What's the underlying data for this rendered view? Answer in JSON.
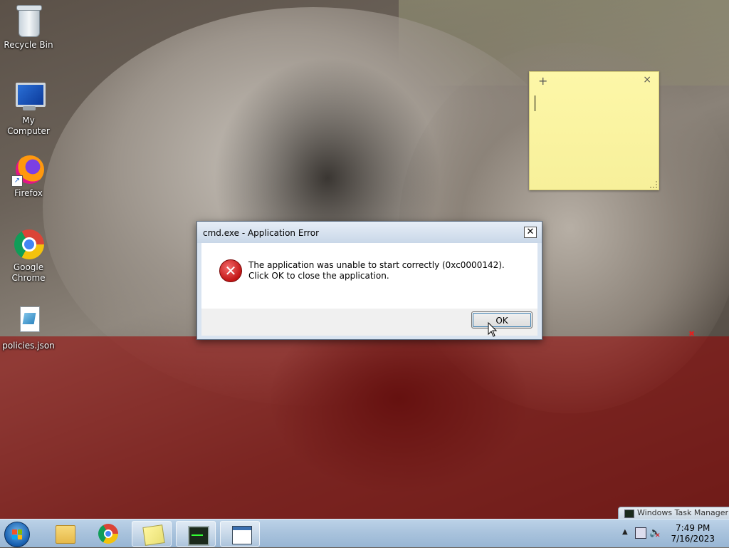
{
  "desktop": {
    "icons": [
      {
        "label": "Recycle Bin",
        "icon": "recycle-bin-icon"
      },
      {
        "label": "My Computer",
        "icon": "computer-icon"
      },
      {
        "label": "Firefox",
        "icon": "firefox-icon"
      },
      {
        "label": "Google Chrome",
        "icon": "chrome-icon"
      },
      {
        "label": "policies.json",
        "icon": "json-file-icon"
      }
    ]
  },
  "sticky_note": {
    "add_symbol": "+",
    "close_symbol": "×"
  },
  "dialog": {
    "title": "cmd.exe - Application Error",
    "close_symbol": "✕",
    "message": "The application was unable to start correctly (0xc0000142). Click OK to close the application.",
    "ok_label": "OK",
    "icon": "error-icon"
  },
  "taskbar": {
    "pinned": [
      {
        "name": "windows-explorer",
        "icon": "folder-icon"
      },
      {
        "name": "google-chrome",
        "icon": "chrome-icon"
      },
      {
        "name": "sticky-notes",
        "icon": "sticky-notes-icon"
      },
      {
        "name": "task-manager",
        "icon": "task-manager-icon"
      },
      {
        "name": "cmd-window",
        "icon": "window-icon"
      }
    ],
    "preview_label": "Windows Task Manager",
    "tray": {
      "show_hidden_symbol": "▲",
      "time": "7:49 PM",
      "date": "7/16/2023"
    }
  }
}
